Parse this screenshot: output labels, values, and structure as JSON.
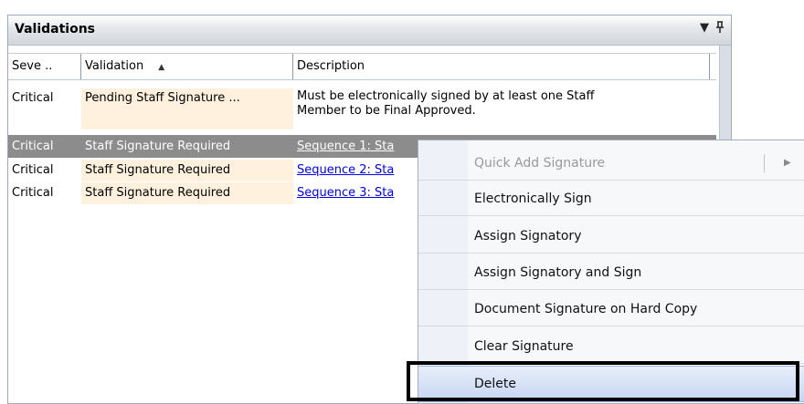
{
  "panel": {
    "title": "Validations",
    "dropdown_icon": "dropdown-arrow-icon",
    "pin_icon": "pin-icon"
  },
  "columns": [
    {
      "label": "Seve .."
    },
    {
      "label": "Validation",
      "sort": "ascending"
    },
    {
      "label": "Description"
    }
  ],
  "rows": [
    {
      "severity": "Critical",
      "validation": "Pending Staff Signature ...",
      "description": "Must be electronically signed by at least one Staff",
      "description_line2": "Member to be Final Approved.",
      "selected": false
    },
    {
      "severity": "Critical",
      "validation": "Staff Signature Required",
      "description": "Sequence 1: Sta",
      "selected": true
    },
    {
      "severity": "Critical",
      "validation": "Staff Signature Required",
      "description": "Sequence 2: Sta",
      "selected": false
    },
    {
      "severity": "Critical",
      "validation": "Staff Signature Required",
      "description": "Sequence 3: Sta",
      "selected": false
    }
  ],
  "context_menu": {
    "items": [
      {
        "label": "Quick Add Signature",
        "disabled": true,
        "submenu": true
      },
      {
        "label": "Electronically Sign"
      },
      {
        "label": "Assign Signatory"
      },
      {
        "label": "Assign Signatory and Sign"
      },
      {
        "label": "Document Signature on Hard Copy"
      },
      {
        "label": "Clear Signature"
      },
      {
        "label": "Delete",
        "hovered": true
      }
    ]
  }
}
